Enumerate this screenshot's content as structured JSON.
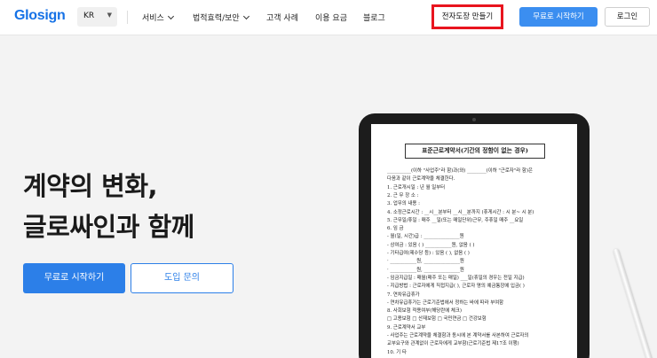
{
  "header": {
    "logo": "Glosign",
    "language": "KR",
    "nav": [
      {
        "label": "서비스",
        "dropdown": true
      },
      {
        "label": "법적효력/보안",
        "dropdown": true
      },
      {
        "label": "고객 사례",
        "dropdown": false
      },
      {
        "label": "이용 요금",
        "dropdown": false
      },
      {
        "label": "블로그",
        "dropdown": false
      }
    ],
    "create_seal_button": "전자도장 만들기",
    "start_free_button": "무료로 시작하기",
    "login_button": "로그인"
  },
  "hero": {
    "title_line1": "계약의 변화,",
    "title_line2": "글로싸인과 함께",
    "start_free_button": "무료로 시작하기",
    "inquiry_button": "도입 문의"
  },
  "document": {
    "title": "표준근로계약서(기간의 정함이 없는 경우)",
    "lines": [
      "__________(이하 \"사업주\"라 함)과(와) ________(이하 \"근로자\"라 함)은",
      "다음과 같이 근로계약을 체결한다.",
      "1. 근로개시일 :        년    월    일부터",
      "2. 근 무 장 소 :",
      "3. 업무의 내용 :",
      "4. 소정근로시간 : __시__분부터 __시__분까지 (휴게시간 : 시 분~ 시 분)",
      "5. 근무일/휴일 : 매주 __일(또는 매일단위)근무, 주휴일 매주 __요일",
      "6. 임  금",
      "   - 월(일, 시간)급 : _______________원",
      "   - 상여금 : 있음 (    ) ___________원, 없음 (    )",
      "   - 기타급여(제수당 등) : 있음 (    ),      없음 (    )",
      "      · ___________원, _______________원",
      "      · ___________원, _______________원",
      "   - 임금지급일 : 매월(매주 또는 매일) ___일(휴일의 경우는 전일 지급)",
      "   - 지급방법 : 근로자에게 직접지급(    ), 근로자 명의 예금통장에 입금(    )",
      "7. 연차유급휴가",
      "   - 연차유급휴가는 근로기준법에서 정하는 바에 따라 부여함",
      "8. 사회보험 적용여부(해당란에 체크)",
      "   □ 고용보험   □ 산재보험   □ 국민연금   □ 건강보험",
      "9. 근로계약서 교부",
      "   - 사업주는 근로계약을 체결함과 동시에 본 계약서를 사본하여 근로자의",
      "     교부요구와 관계없이 근로자에게 교부함(근로기준법 제17조 이행)",
      "10. 기  타"
    ]
  }
}
